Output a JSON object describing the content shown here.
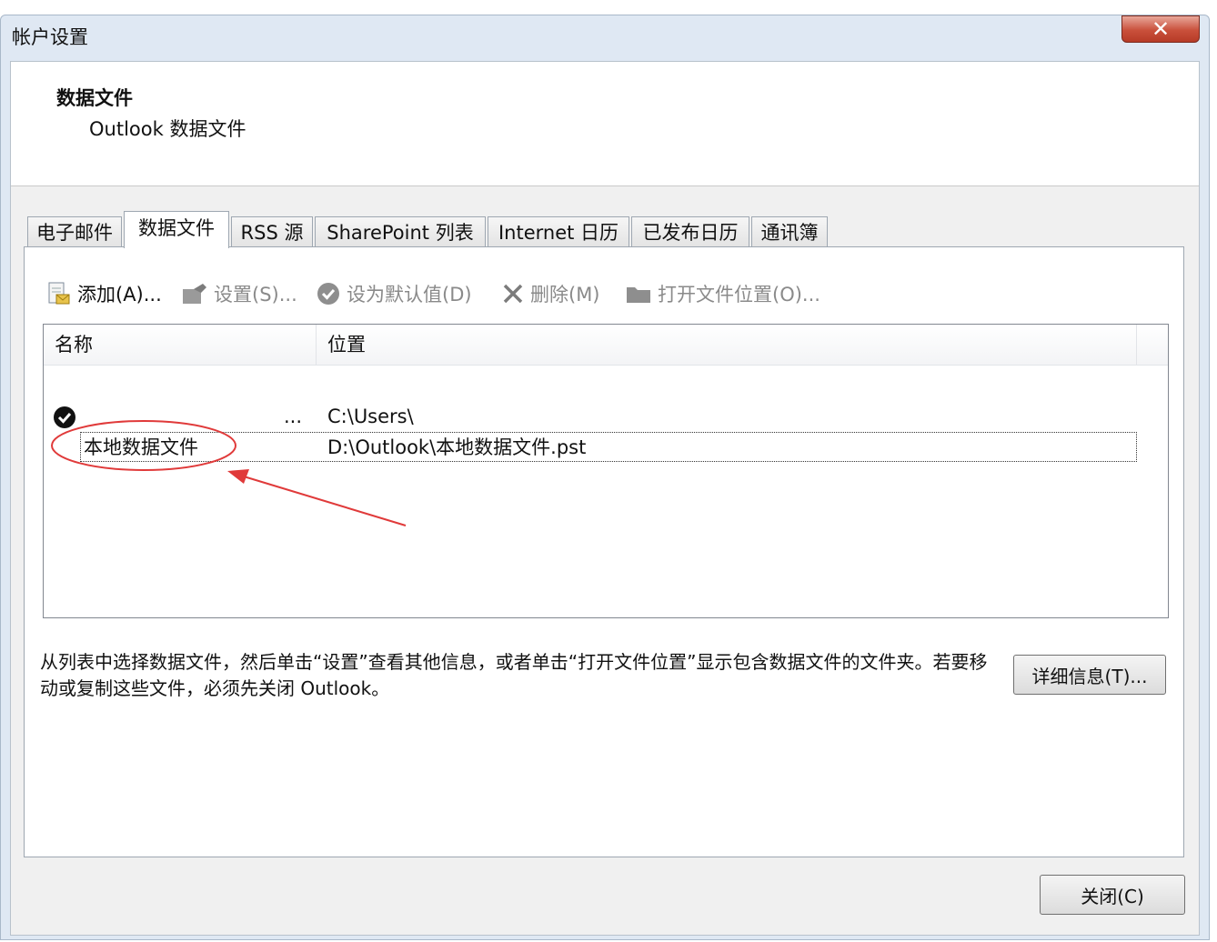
{
  "window": {
    "title": "帐户设置",
    "close_glyph": "✕"
  },
  "header": {
    "title": "数据文件",
    "subtitle": "Outlook 数据文件"
  },
  "tabs": [
    {
      "label": "电子邮件"
    },
    {
      "label": "数据文件",
      "active": true
    },
    {
      "label": "RSS 源"
    },
    {
      "label": "SharePoint 列表"
    },
    {
      "label": "Internet 日历"
    },
    {
      "label": "已发布日历"
    },
    {
      "label": "通讯簿"
    }
  ],
  "toolbar": {
    "add": "添加(A)...",
    "settings": "设置(S)...",
    "set_default": "设为默认值(D)",
    "remove": "删除(M)",
    "open_location": "打开文件位置(O)..."
  },
  "list": {
    "columns": {
      "name": "名称",
      "location": "位置"
    },
    "rows": [
      {
        "name": "...",
        "location": "C:\\Users\\",
        "default": true
      },
      {
        "name": "本地数据文件",
        "location": "D:\\Outlook\\本地数据文件.pst",
        "selected": true
      }
    ]
  },
  "description": "从列表中选择数据文件，然后单击“设置”查看其他信息，或者单击“打开文件位置”显示包含数据文件的文件夹。若要移动或复制这些文件，必须先关闭 Outlook。",
  "buttons": {
    "details": "详细信息(T)...",
    "close": "关闭(C)"
  },
  "colors": {
    "annotation": "#e03a3a",
    "window_frame": "#dfe8f3",
    "close_button": "#c9503b"
  }
}
